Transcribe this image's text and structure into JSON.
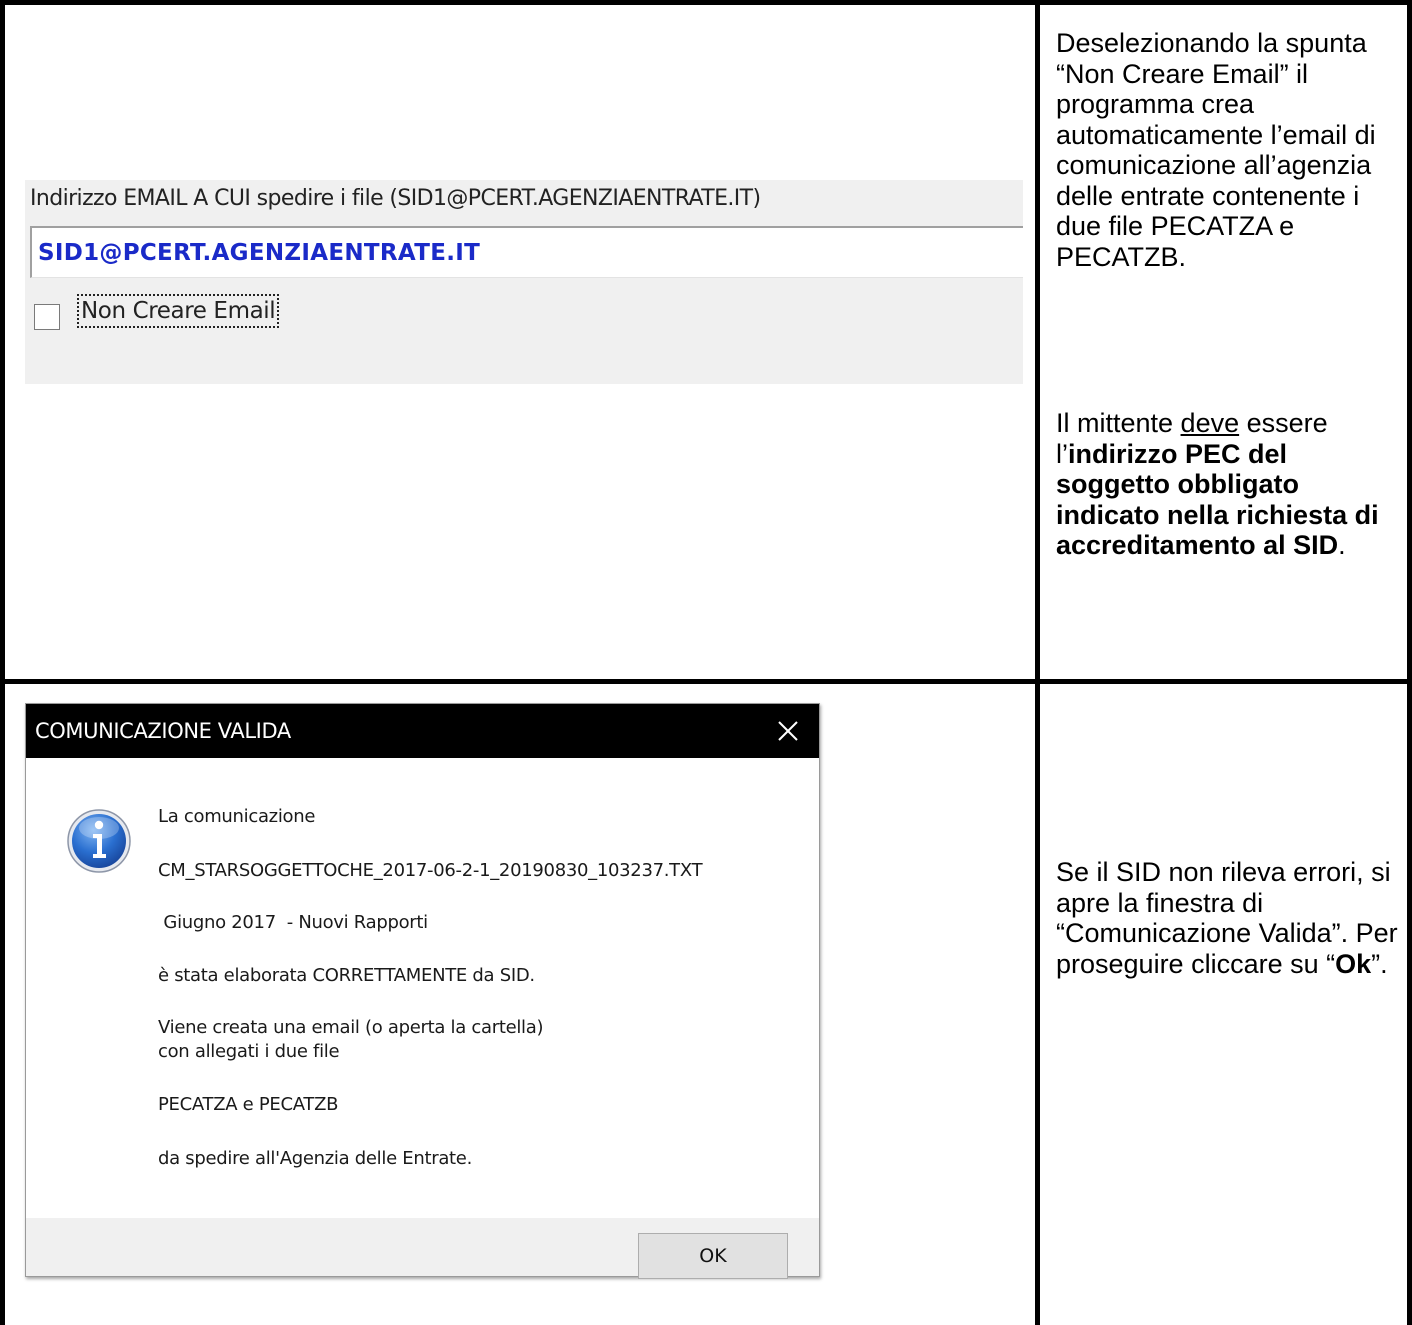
{
  "email_settings": {
    "label": "Indirizzo EMAIL A CUI spedire i file (SID1@PCERT.AGENZIAENTRATE.IT)",
    "value": "SID1@PCERT.AGENZIAENTRATE.IT",
    "checkbox_label": "Non Creare Email",
    "checkbox_checked": false
  },
  "note_top": {
    "p1": "Deselezionando la spunta “Non Creare Email” il programma crea automaticamente l’email di comunicazione all’agenzia delle entrate contenente i due file PECATZA e PECATZB.",
    "p2_pre": "Il mittente ",
    "p2_underline": "deve",
    "p2_mid": " essere l’",
    "p2_bold": "indirizzo PEC del soggetto obbligato indicato nella richiesta di accreditamento al SID",
    "p2_end": "."
  },
  "dialog": {
    "title": "COMUNICAZIONE VALIDA",
    "lines": [
      "La comunicazione",
      "CM_STARSOGGETTOCHE_2017-06-2-1_20190830_103237.TXT",
      " Giugno 2017  - Nuovi Rapporti",
      "è stata elaborata CORRETTAMENTE da SID.",
      "Viene creata una email (o aperta la cartella)",
      "con allegati i due file",
      "PECATZA e PECATZB",
      "da spedire all'Agenzia delle Entrate."
    ],
    "ok_label": "OK",
    "icon": "info-icon",
    "close_icon": "close-icon"
  },
  "note_bottom": {
    "pre": "Se il SID non rileva errori, si apre la finestra di “Comunicazione Valida”. Per proseguire cliccare su “",
    "bold": "Ok",
    "post": "”."
  }
}
